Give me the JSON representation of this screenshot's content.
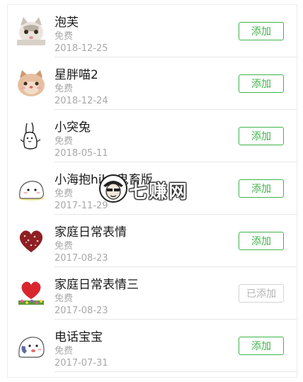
{
  "stickers": [
    {
      "title": "泡芙",
      "price": "免费",
      "date": "2018-12-25",
      "button": "添加",
      "state": "add",
      "icon": "cat-face-sticker-icon"
    },
    {
      "title": "星胖喵2",
      "price": "免费",
      "date": "2018-12-24",
      "button": "添加",
      "state": "add",
      "icon": "fat-cat-sticker-icon"
    },
    {
      "title": "小突兔",
      "price": "免费",
      "date": "2018-05-11",
      "button": "添加",
      "state": "add",
      "icon": "sketch-rabbit-sticker-icon"
    },
    {
      "title": "小海抱hibo鬼畜版",
      "price": "免费",
      "date": "2017-11-29",
      "button": "添加",
      "state": "add",
      "icon": "white-blob-sticker-icon"
    },
    {
      "title": "家庭日常表情",
      "price": "免费",
      "date": "2017-08-23",
      "button": "添加",
      "state": "add",
      "icon": "red-heart-sticker-icon"
    },
    {
      "title": "家庭日常表情三",
      "price": "免费",
      "date": "2017-08-23",
      "button": "已添加",
      "state": "added",
      "icon": "heart-flowers-sticker-icon"
    },
    {
      "title": "电话宝宝",
      "price": "免费",
      "date": "2017-07-31",
      "button": "添加",
      "state": "add",
      "icon": "phone-baby-sticker-icon"
    }
  ],
  "watermark": {
    "text": "七赚网",
    "icon": "hacker-avatar-icon"
  },
  "colors": {
    "accent": "#3fb54a",
    "muted": "#a8a8a8",
    "disabled": "#b3b3b3"
  }
}
